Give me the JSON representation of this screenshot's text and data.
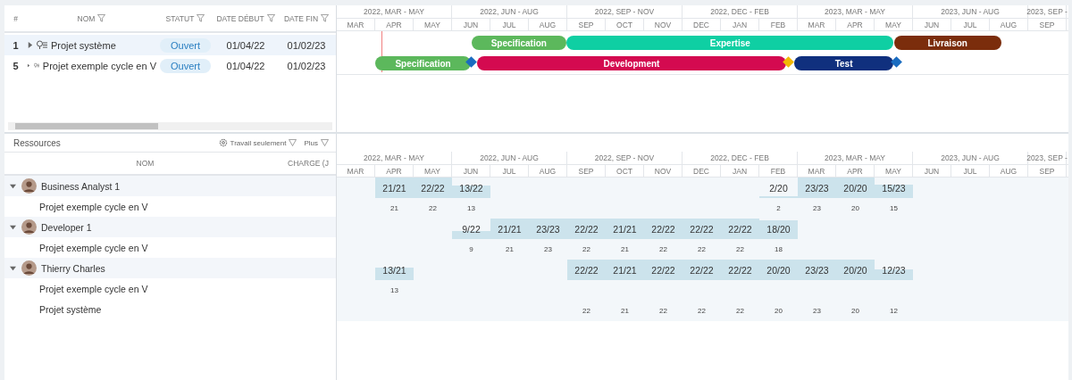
{
  "project_grid": {
    "columns": [
      {
        "label": "#",
        "filter": false
      },
      {
        "label": "NOM",
        "filter": true
      },
      {
        "label": "STATUT",
        "filter": true
      },
      {
        "label": "DATE DÉBUT",
        "filter": true
      },
      {
        "label": "DATE FIN",
        "filter": true
      }
    ]
  },
  "timeline": {
    "quarters": [
      "2022, MAR - MAY",
      "2022, JUN - AUG",
      "2022, SEP - NOV",
      "2022, DEC - FEB",
      "2023, MAR - MAY",
      "2023, JUN - AUG",
      "2023, SEP -"
    ],
    "months": [
      "MAR",
      "APR",
      "MAY",
      "JUN",
      "JUL",
      "AUG",
      "SEP",
      "OCT",
      "NOV",
      "DEC",
      "JAN",
      "FEB",
      "MAR",
      "APR",
      "MAY",
      "JUN",
      "JUL",
      "AUG",
      "SEP"
    ]
  },
  "projects": [
    {
      "id": "1",
      "name": "Projet système",
      "status": "Ouvert",
      "start": "01/04/22",
      "end": "01/02/23",
      "expanded": false,
      "selected": true,
      "tasks": [
        {
          "kind": "bar",
          "label": "Specification",
          "color": "#5cb85c"
        },
        {
          "kind": "bar",
          "label": "Expertise",
          "color": "#0fcfa3"
        },
        {
          "kind": "bar",
          "label": "Livraison",
          "color": "#7b2d0c"
        }
      ]
    },
    {
      "id": "5",
      "name": "Projet exemple cycle en V",
      "status": "Ouvert",
      "start": "01/04/22",
      "end": "01/02/23",
      "expanded": false,
      "selected": false,
      "tasks": [
        {
          "kind": "bar",
          "label": "Specification",
          "color": "#5cb85c"
        },
        {
          "kind": "milestone",
          "color": "#1a6cc0"
        },
        {
          "kind": "bar",
          "label": "Development",
          "color": "#d40a50"
        },
        {
          "kind": "milestone",
          "color": "#f2b705"
        },
        {
          "kind": "bar",
          "label": "Test",
          "color": "#10307e"
        },
        {
          "kind": "milestone",
          "color": "#1a6cc0"
        }
      ]
    }
  ],
  "resources": {
    "title": "Ressources",
    "filters": [
      {
        "label": "Travail seulement",
        "gear": true
      },
      {
        "label": "Plus",
        "gear": false
      }
    ],
    "columns": [
      "NOM",
      "CHARGE (J"
    ],
    "timeline": {
      "quarters": [
        "2022, MAR - MAY",
        "2022, JUN - AUG",
        "2022, SEP - NOV",
        "2022, DEC - FEB",
        "2023, MAR - MAY",
        "2023, JUN - AUG",
        "2023, SEP -"
      ],
      "months": [
        "MAR",
        "APR",
        "MAY",
        "JUN",
        "JUL",
        "AUG",
        "SEP",
        "OCT",
        "NOV",
        "DEC",
        "JAN",
        "FEB",
        "MAR",
        "APR",
        "MAY",
        "JUN",
        "JUL",
        "AUG",
        "SEP"
      ]
    },
    "people": [
      {
        "name": "Business Analyst 1",
        "expanded": true,
        "loads": [
          "21/21",
          "22/22",
          "13/22",
          "2/20",
          "23/23",
          "20/20",
          "15/23"
        ],
        "children": [
          {
            "name": "Projet exemple cycle en V",
            "loads": [
              "21",
              "22",
              "13",
              "2",
              "23",
              "20",
              "15"
            ]
          }
        ]
      },
      {
        "name": "Developer 1",
        "expanded": true,
        "loads": [
          "9/22",
          "21/21",
          "23/23",
          "22/22",
          "21/21",
          "22/22",
          "22/22",
          "22/22",
          "18/20"
        ],
        "children": [
          {
            "name": "Projet exemple cycle en V",
            "loads": [
              "9",
              "21",
              "23",
              "22",
              "21",
              "22",
              "22",
              "22",
              "18"
            ]
          }
        ]
      },
      {
        "name": "Thierry Charles",
        "expanded": true,
        "loads": [
          "13/21",
          "22/22",
          "21/21",
          "22/22",
          "22/22",
          "22/22",
          "20/20",
          "23/23",
          "20/20",
          "12/23"
        ],
        "children": [
          {
            "name": "Projet exemple cycle en V",
            "loads": [
              "13"
            ]
          },
          {
            "name": "Projet système",
            "loads": [
              "22",
              "21",
              "22",
              "22",
              "22",
              "20",
              "23",
              "20",
              "12"
            ]
          }
        ]
      }
    ]
  }
}
